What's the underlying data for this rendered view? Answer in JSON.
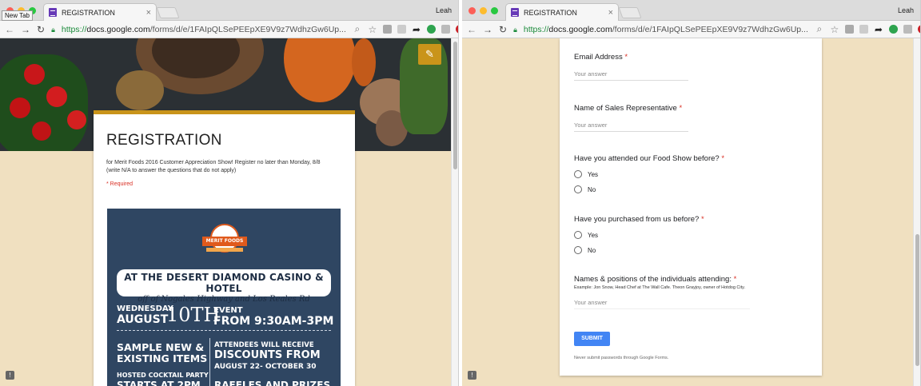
{
  "browser": {
    "tab_title": "REGISTRATION",
    "tab_close": "×",
    "user": "Leah",
    "tooltip": "New Tab",
    "url_scheme": "https://",
    "url_host": "docs.google.com",
    "url_path": "/forms/d/e/1FAIpQLSePEEpXE9V9z7WdhzGw6Up...",
    "url_path_right": "/forms/d/e/1FAIpQLSePEEpXE9V9z7WdhzGw6Up..."
  },
  "colors": {
    "accent": "#c9941a",
    "page_bg": "#f0e0c0",
    "required": "#d93025",
    "submit": "#4285f4"
  },
  "form": {
    "title": "REGISTRATION",
    "description_1": "for Merit Foods 2016 Customer Appreciation Show!  Register no later than Monday, 8/8",
    "description_2": "(write N/A to answer the questions that do not apply)",
    "required_note": "* Required"
  },
  "poster": {
    "logo": "MERIT FOODS",
    "line1": "AT THE DESERT DIAMOND CASINO & HOTEL",
    "line2": "off of Nogales Highway and Los Reales Rd",
    "date_weekday": "WEDNESDAY",
    "date_month": "AUGUST",
    "date_day": "10TH",
    "event_label": "EVENT",
    "event_time": "FROM 9:30AM-3PM",
    "left_1": "SAMPLE NEW &",
    "left_2": "EXISTING ITEMS",
    "left_3": "HOSTED COCKTAIL PARTY",
    "left_4": "STARTS AT 2PM",
    "right_1": "ATTENDEES WILL RECEIVE",
    "right_2": "DISCOUNTS FROM",
    "right_3": "AUGUST 22- OCTOBER 30",
    "right_4": "RAFFLES AND PRIZES"
  },
  "questions": {
    "email": {
      "label": "Email Address",
      "placeholder": "Your answer"
    },
    "sales_rep": {
      "label": "Name of Sales Representative",
      "placeholder": "Your answer"
    },
    "attended": {
      "label": "Have you attended our Food Show before?",
      "options": [
        "Yes",
        "No"
      ]
    },
    "purchased": {
      "label": "Have you purchased from us before?",
      "options": [
        "Yes",
        "No"
      ]
    },
    "names": {
      "label": "Names & positions of the individuals attending:",
      "help": "Example: Jon Snow, Head Chef at The Wall Cafe. Theon Grayjoy, owner of Hotdog City.",
      "placeholder": "Your answer"
    },
    "required_mark": "*"
  },
  "submit_label": "SUBMIT",
  "never_note": "Never submit passwords through Google Forms."
}
